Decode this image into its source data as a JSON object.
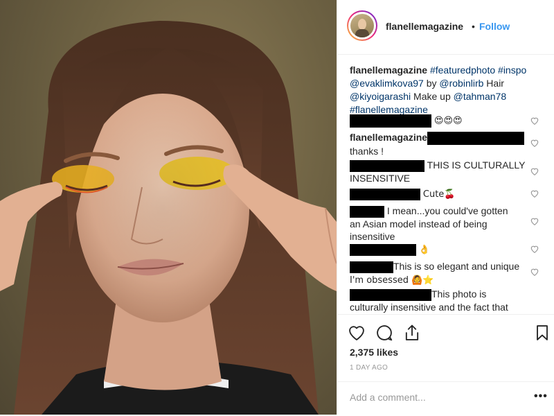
{
  "header": {
    "username": "flanellemagazine",
    "dot": "•",
    "follow_label": "Follow"
  },
  "caption": {
    "username": "flanellemagazine",
    "tags": [
      "#featuredphoto",
      "#inspo",
      "@evaklimkova97",
      "by",
      "@robinlirb",
      "Hair",
      "@kiyoigarashi",
      "Make up",
      "@tahman78",
      "#flanellemagazine"
    ]
  },
  "comments": [
    {
      "text": "😍😍😍"
    },
    {
      "username": "flanellemagazine",
      "text": "thanks !"
    },
    {
      "text": "THIS IS CULTURALLY",
      "text2": "INSENSITIVE"
    },
    {
      "text": "Cute🍒"
    },
    {
      "text": "I mean...you could've gotten",
      "text2": "an Asian model instead of being",
      "text3": "insensitive"
    },
    {
      "text": "👌"
    },
    {
      "text": "This is so elegant and unique",
      "text2": "I'm obsessed 🙆⭐"
    },
    {
      "text": "This photo is",
      "text2": "culturally insensitive and the fact that"
    }
  ],
  "likes": "2,375 likes",
  "date": "1 DAY AGO",
  "add_comment": {
    "placeholder": "Add a comment..."
  },
  "more_label": "•••",
  "colors": {
    "follow": "#3897f0",
    "tag": "#003569",
    "muted": "#999999"
  },
  "icons": [
    "heart-icon",
    "comment-icon",
    "share-icon",
    "bookmark-icon"
  ]
}
